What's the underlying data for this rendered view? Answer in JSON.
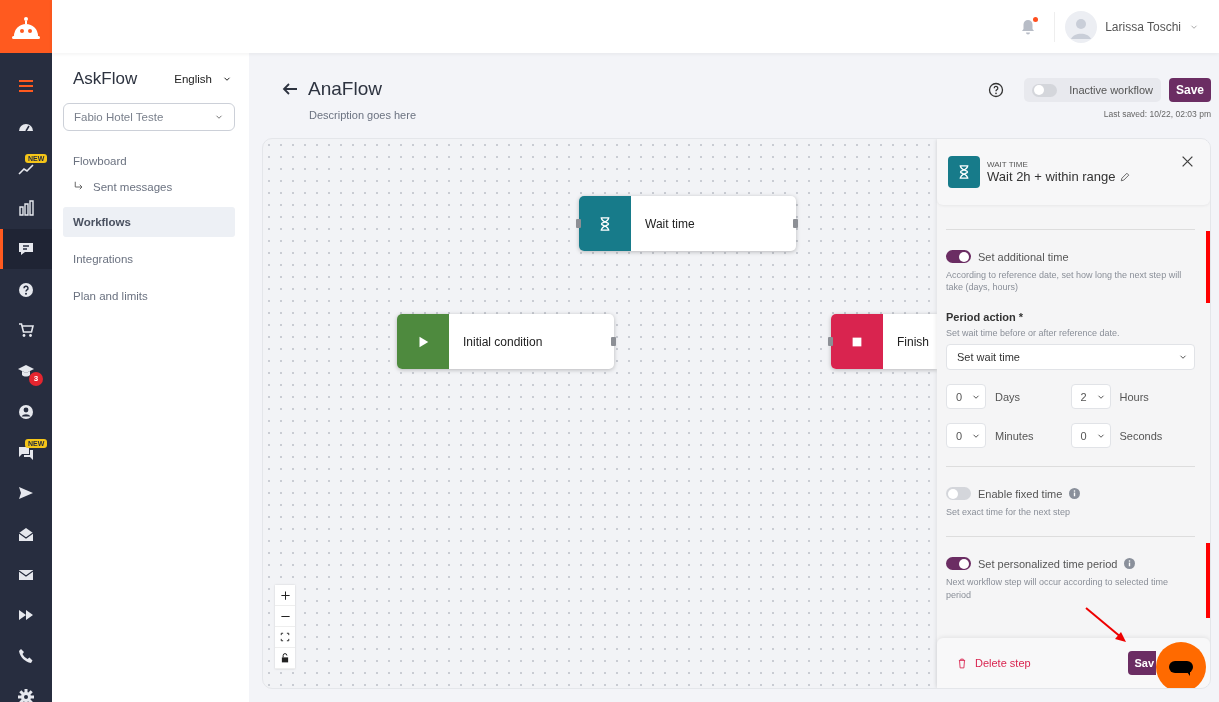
{
  "rail": {
    "items": [
      {
        "selected": false
      },
      {
        "selected": false
      },
      {
        "selected": false,
        "badge": "NEW"
      },
      {
        "selected": false
      },
      {
        "selected": true
      },
      {
        "selected": false
      },
      {
        "selected": false
      },
      {
        "selected": false,
        "badge": "3"
      },
      {
        "selected": false
      },
      {
        "selected": false,
        "badge": "NEW"
      },
      {
        "selected": false
      },
      {
        "selected": false
      },
      {
        "selected": false
      },
      {
        "selected": false
      },
      {
        "selected": false
      },
      {
        "selected": false
      }
    ]
  },
  "topbar": {
    "notification_unread": true,
    "user": "Larissa Toschi"
  },
  "sidebar": {
    "brand": "AskFlow",
    "language": "English",
    "account": "Fabio Hotel Teste",
    "items": [
      {
        "label": "Flowboard",
        "kind": "link",
        "selected": false
      },
      {
        "label": "Sent messages",
        "kind": "sub",
        "selected": false
      },
      {
        "label": "Workflows",
        "kind": "link",
        "selected": true
      },
      {
        "label": "Integrations",
        "kind": "link",
        "selected": false
      },
      {
        "label": "Plan and limits",
        "kind": "link",
        "selected": false
      }
    ]
  },
  "header": {
    "title": "AnaFlow",
    "description": "Description goes here",
    "status": {
      "label": "Inactive workflow",
      "on": false
    },
    "save": "Save",
    "last_saved": "Last saved: 10/22, 02:03 pm"
  },
  "canvas": {
    "nodes": [
      {
        "kind": "wait",
        "label": "Wait time"
      },
      {
        "kind": "start",
        "label": "Initial condition"
      },
      {
        "kind": "finish",
        "label": "Finish"
      }
    ]
  },
  "panel": {
    "eyebrow": "WAIT TIME",
    "title": "Wait 2h + within range",
    "toggles": [
      {
        "label": "Set additional time",
        "on": true,
        "info": false,
        "help": "According to reference date, set how long the next step will take (days, hours)"
      },
      {
        "label": "Enable fixed time",
        "on": false,
        "info": true,
        "help": "Set exact time for the next step"
      },
      {
        "label": "Set personalized time period",
        "on": true,
        "info": true,
        "help": "Next workflow step will occur according to selected time period"
      }
    ],
    "period_action": {
      "label": "Period action *",
      "hint": "Set wait time before or after reference date.",
      "value": "Set wait time"
    },
    "duration": [
      {
        "value": "0",
        "unit": "Days"
      },
      {
        "value": "2",
        "unit": "Hours"
      },
      {
        "value": "0",
        "unit": "Minutes"
      },
      {
        "value": "0",
        "unit": "Seconds"
      }
    ],
    "delete": "Delete step",
    "save": "Sav"
  }
}
